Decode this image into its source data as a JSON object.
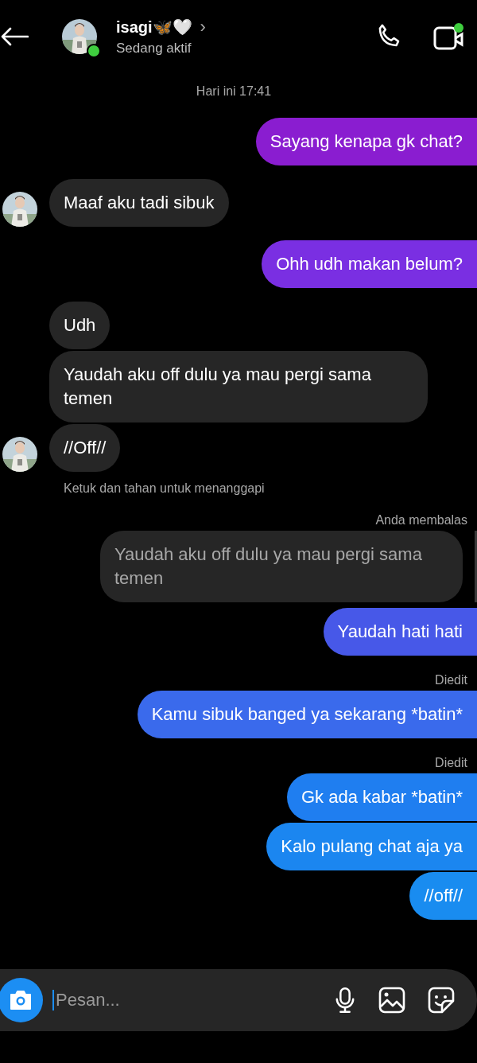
{
  "header": {
    "name": "isagi🦋🤍",
    "chevron": "›",
    "status": "Sedang aktif",
    "online": true,
    "video_active": true
  },
  "messages": [
    {
      "kind": "time",
      "text": "Hari ini 17:41"
    },
    {
      "kind": "sent",
      "text": "Sayang kenapa gk chat?",
      "color": "#8a1dd0"
    },
    {
      "kind": "received",
      "text": "Maaf aku tadi sibuk",
      "avatar": true
    },
    {
      "kind": "sent",
      "text": "Ohh udh makan belum?",
      "color": "#7a2fe2"
    },
    {
      "kind": "received",
      "text": "Udh",
      "avatar": false
    },
    {
      "kind": "received",
      "text": "Yaudah aku off dulu ya mau pergi sama temen",
      "avatar": false
    },
    {
      "kind": "received",
      "text": "//Off//",
      "avatar": true
    },
    {
      "kind": "hint",
      "text": "Ketuk dan tahan untuk menanggapi"
    },
    {
      "kind": "label",
      "text": "Anda membalas"
    },
    {
      "kind": "quoted",
      "text": "Yaudah aku off dulu ya mau pergi sama temen"
    },
    {
      "kind": "sent",
      "text": "Yaudah hati hati",
      "color": "#4758e8"
    },
    {
      "kind": "label",
      "text": "Diedit"
    },
    {
      "kind": "sent",
      "text": "Kamu sibuk banged ya sekarang *batin*",
      "color": "#3a6aec"
    },
    {
      "kind": "label",
      "text": "Diedit"
    },
    {
      "kind": "sent",
      "text": "Gk ada kabar *batin*",
      "color": "#1f7ef0"
    },
    {
      "kind": "sent",
      "text": "Kalo pulang chat aja ya",
      "color": "#1b86f0"
    },
    {
      "kind": "sent",
      "text": "//off//",
      "color": "#198cf0"
    }
  ],
  "composer": {
    "placeholder": "Pesan..."
  }
}
